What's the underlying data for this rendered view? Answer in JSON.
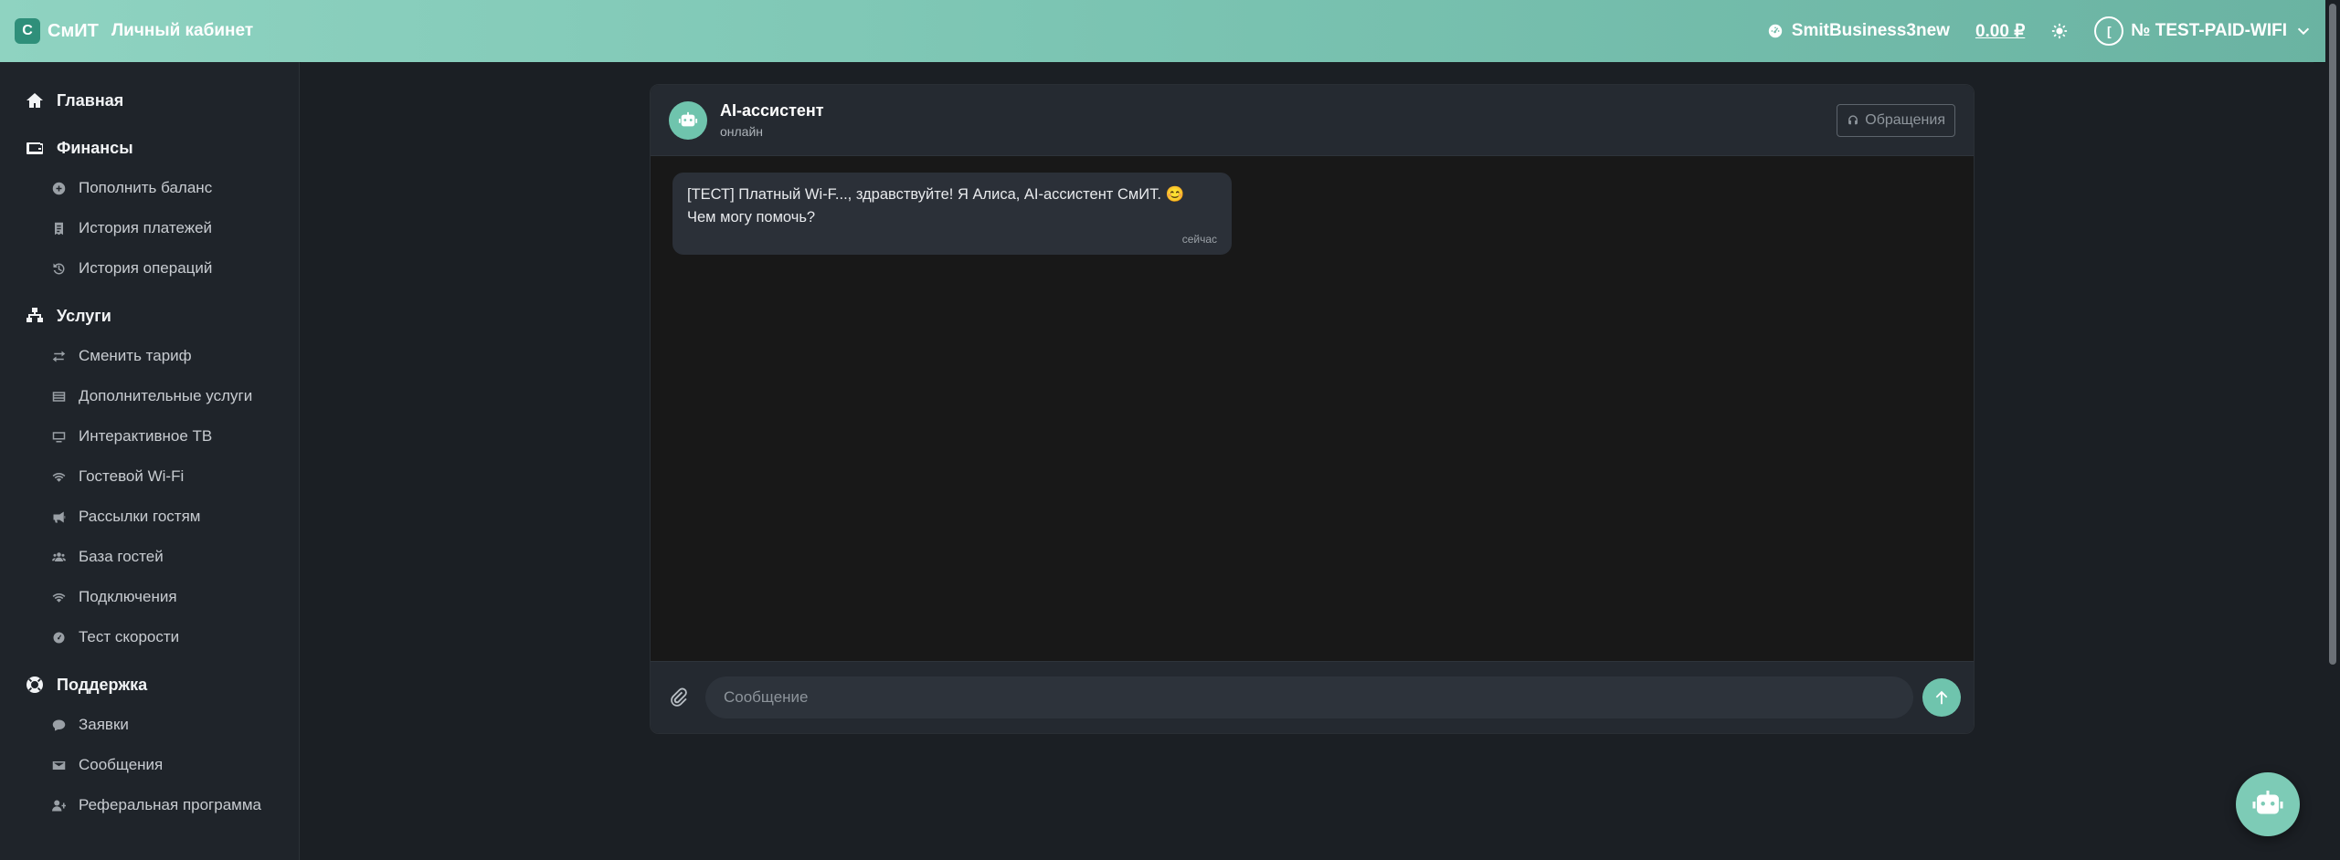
{
  "header": {
    "logo_mark": "С",
    "logo_text": "СмИТ",
    "cabinet_label": "Личный кабинет",
    "account_name": "SmitBusiness3new",
    "balance": "0.00 ₽",
    "avatar_initial": "[",
    "user_label": "№ TEST-PAID-WIFI"
  },
  "sidebar": {
    "sections": [
      {
        "label": "Главная",
        "icon": "home-icon",
        "items": []
      },
      {
        "label": "Финансы",
        "icon": "wallet-icon",
        "items": [
          {
            "label": "Пополнить баланс",
            "icon": "plus-circle-icon"
          },
          {
            "label": "История платежей",
            "icon": "receipt-icon"
          },
          {
            "label": "История операций",
            "icon": "history-icon"
          }
        ]
      },
      {
        "label": "Услуги",
        "icon": "network-icon",
        "items": [
          {
            "label": "Сменить тариф",
            "icon": "exchange-icon"
          },
          {
            "label": "Дополнительные услуги",
            "icon": "list-icon"
          },
          {
            "label": "Интерактивное ТВ",
            "icon": "tv-icon"
          },
          {
            "label": "Гостевой Wi-Fi",
            "icon": "wifi-icon"
          },
          {
            "label": "Рассылки гостям",
            "icon": "megaphone-icon"
          },
          {
            "label": "База гостей",
            "icon": "users-icon"
          },
          {
            "label": "Подключения",
            "icon": "wifi-icon"
          },
          {
            "label": "Тест скорости",
            "icon": "gauge-icon"
          }
        ]
      },
      {
        "label": "Поддержка",
        "icon": "lifebuoy-icon",
        "items": [
          {
            "label": "Заявки",
            "icon": "chat-icon"
          },
          {
            "label": "Сообщения",
            "icon": "envelope-icon"
          },
          {
            "label": "Реферальная программа",
            "icon": "user-plus-icon"
          }
        ]
      }
    ]
  },
  "chat": {
    "title": "AI-ассистент",
    "status": "онлайн",
    "tickets_label": "Обращения",
    "messages": [
      {
        "text_line1": "[ТЕСТ] Платный Wi-F..., здравствуйте! Я Алиса, AI-ассистент СмИТ. 😊",
        "text_line2": "Чем могу помочь?",
        "time": "сейчас"
      }
    ],
    "input_placeholder": "Сообщение"
  },
  "colors": {
    "accent": "#6fc4ad",
    "header_start": "#8fd3c1",
    "header_end": "#6ab3a2",
    "background": "#1b1f24"
  }
}
